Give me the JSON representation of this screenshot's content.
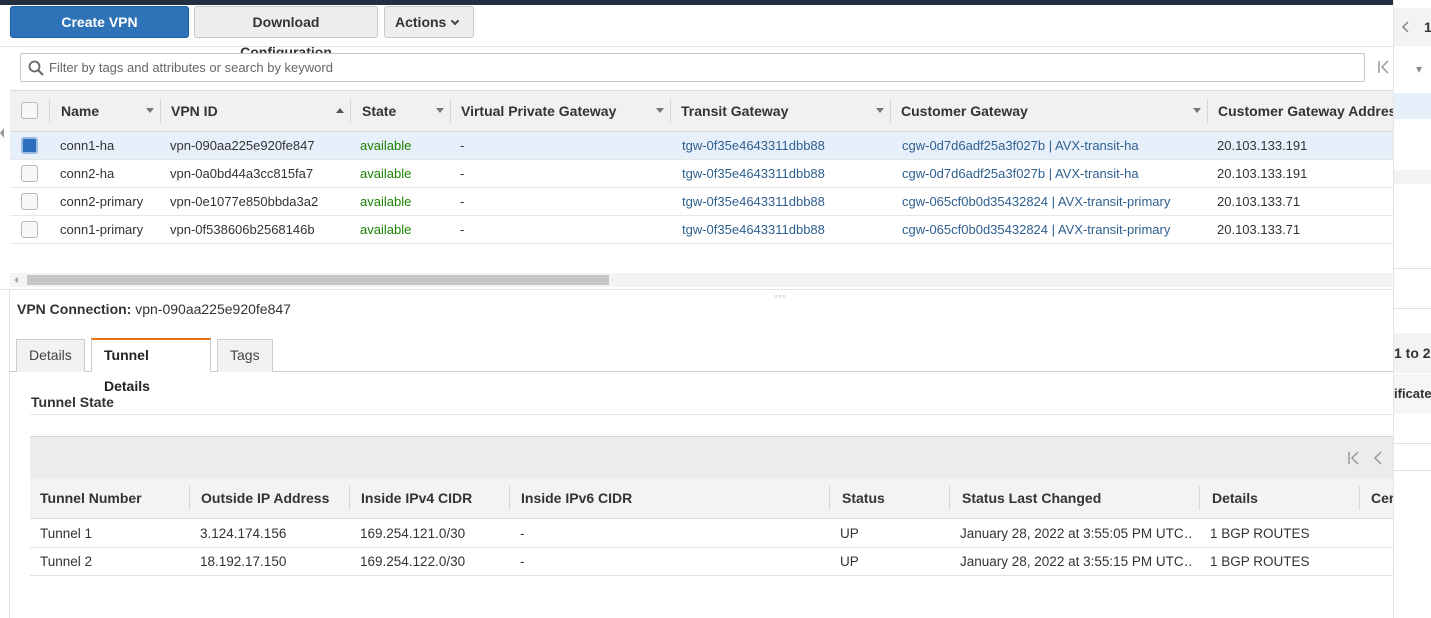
{
  "toolbar": {
    "create_label": "Create VPN Connection",
    "download_label": "Download Configuration",
    "actions_label": "Actions"
  },
  "filter": {
    "placeholder": "Filter by tags and attributes or search by keyword"
  },
  "grid": {
    "columns": [
      "Name",
      "VPN ID",
      "State",
      "Virtual Private Gateway",
      "Transit Gateway",
      "Customer Gateway",
      "Customer Gateway Address"
    ],
    "sorted_column": "VPN ID",
    "rows": [
      {
        "selected": true,
        "name": "conn1-ha",
        "vpn_id": "vpn-090aa225e920fe847",
        "state": "available",
        "vgw": "-",
        "tgw": "tgw-0f35e4643311dbb88",
        "cgw": "cgw-0d7d6adf25a3f027b | AVX-transit-ha",
        "cgw_addr": "20.103.133.191"
      },
      {
        "selected": false,
        "name": "conn2-ha",
        "vpn_id": "vpn-0a0bd44a3cc815fa7",
        "state": "available",
        "vgw": "-",
        "tgw": "tgw-0f35e4643311dbb88",
        "cgw": "cgw-0d7d6adf25a3f027b | AVX-transit-ha",
        "cgw_addr": "20.103.133.191"
      },
      {
        "selected": false,
        "name": "conn2-primary",
        "vpn_id": "vpn-0e1077e850bbda3a2",
        "state": "available",
        "vgw": "-",
        "tgw": "tgw-0f35e4643311dbb88",
        "cgw": "cgw-065cf0b0d35432824 | AVX-transit-primary",
        "cgw_addr": "20.103.133.71"
      },
      {
        "selected": false,
        "name": "conn1-primary",
        "vpn_id": "vpn-0f538606b2568146b",
        "state": "available",
        "vgw": "-",
        "tgw": "tgw-0f35e4643311dbb88",
        "cgw": "cgw-065cf0b0d35432824 | AVX-transit-primary",
        "cgw_addr": "20.103.133.71"
      }
    ]
  },
  "details": {
    "label": "VPN Connection:",
    "value": "vpn-090aa225e920fe847",
    "tabs": [
      "Details",
      "Tunnel Details",
      "Tags"
    ],
    "active_tab": "Tunnel Details",
    "section_title": "Tunnel State"
  },
  "tunnels": {
    "columns": [
      "Tunnel Number",
      "Outside IP Address",
      "Inside IPv4 CIDR",
      "Inside IPv6 CIDR",
      "Status",
      "Status Last Changed",
      "Details",
      "Cer"
    ],
    "rows": [
      {
        "number": "Tunnel 1",
        "outside_ip": "3.124.174.156",
        "inside_v4": "169.254.121.0/30",
        "inside_v6": "-",
        "status": "UP",
        "changed": "January 28, 2022 at 3:55:05 PM UTC…",
        "details": "1 BGP ROUTES"
      },
      {
        "number": "Tunnel 2",
        "outside_ip": "18.192.17.150",
        "inside_v4": "169.254.122.0/30",
        "inside_v6": "-",
        "status": "UP",
        "changed": "January 28, 2022 at 3:55:15 PM UTC…",
        "details": "1 BGP ROUTES"
      }
    ]
  },
  "right_panel": {
    "page_fragment": "1",
    "range_fragment": "1 to 2",
    "column_fragment": "ificate"
  },
  "colors": {
    "primary": "#2e73b8",
    "status_ok": "#1d8102",
    "link": "#2f5f8f",
    "active_tab_accent": "#ec7211"
  }
}
